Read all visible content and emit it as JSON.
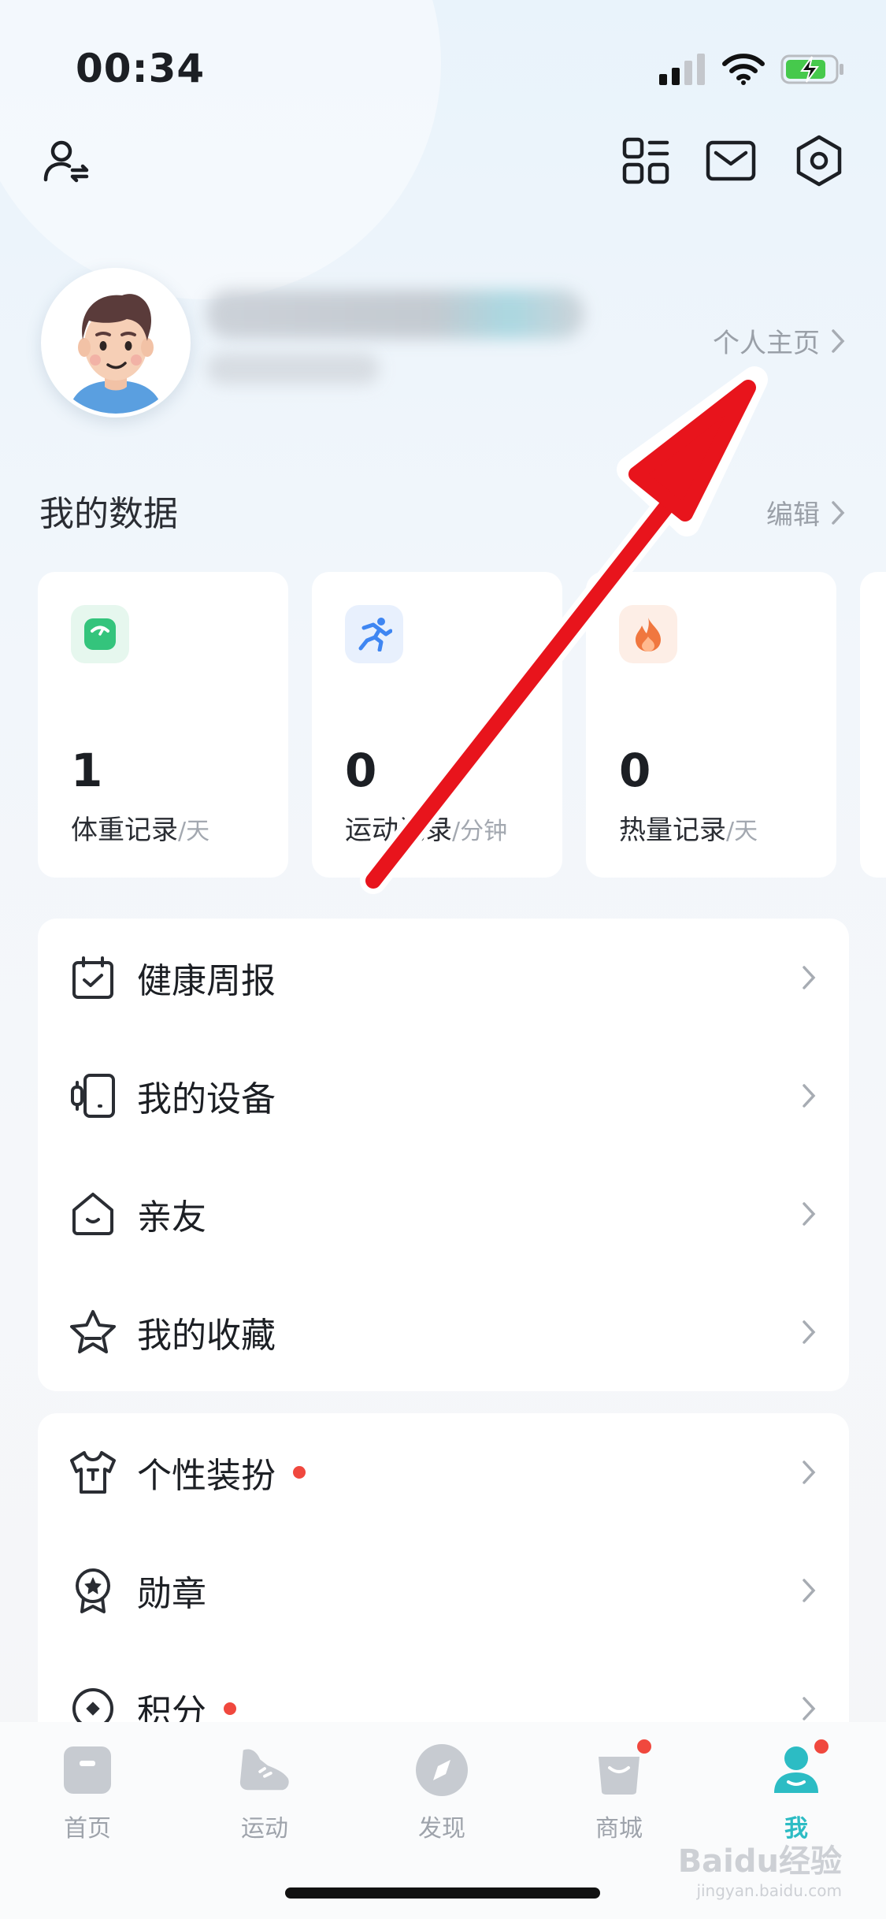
{
  "status_bar": {
    "time": "00:34"
  },
  "top_icons": [
    "switch-account-icon",
    "qr-grid-icon",
    "mail-icon",
    "settings-icon"
  ],
  "profile": {
    "homepage_link": "个人主页"
  },
  "my_data": {
    "title": "我的数据",
    "edit_label": "编辑",
    "cards": [
      {
        "value": "1",
        "label": "体重记录",
        "unit": "/天",
        "icon": "scale-icon",
        "color": "#34c47c"
      },
      {
        "value": "0",
        "label": "运动记录",
        "unit": "/分钟",
        "icon": "runner-icon",
        "color": "#3f86f2"
      },
      {
        "value": "0",
        "label": "热量记录",
        "unit": "/天",
        "icon": "flame-icon",
        "color": "#f0773f"
      }
    ]
  },
  "menu_group_1": [
    {
      "label": "健康周报",
      "icon": "calendar-check-icon"
    },
    {
      "label": "我的设备",
      "icon": "device-icon"
    },
    {
      "label": "亲友",
      "icon": "home-smile-icon"
    },
    {
      "label": "我的收藏",
      "icon": "star-icon"
    }
  ],
  "menu_group_2": [
    {
      "label": "个性装扮",
      "icon": "tshirt-icon",
      "dot": true
    },
    {
      "label": "勋章",
      "icon": "medal-icon",
      "dot": false
    },
    {
      "label": "积分",
      "icon": "coin-icon",
      "dot": true
    }
  ],
  "bottom_nav": [
    {
      "label": "首页",
      "icon": "home-tab-icon",
      "badge": false,
      "active": false
    },
    {
      "label": "运动",
      "icon": "shoe-tab-icon",
      "badge": false,
      "active": false
    },
    {
      "label": "发现",
      "icon": "compass-tab-icon",
      "badge": false,
      "active": false
    },
    {
      "label": "商城",
      "icon": "bag-tab-icon",
      "badge": true,
      "active": false
    },
    {
      "label": "我",
      "icon": "user-tab-icon",
      "badge": true,
      "active": true
    }
  ],
  "colors": {
    "accent": "#2cbcc4",
    "badge": "#f0483e",
    "arrow": "#e8141c"
  },
  "watermark": {
    "text": "Baidu经验",
    "sub": "jingyan.baidu.com"
  }
}
